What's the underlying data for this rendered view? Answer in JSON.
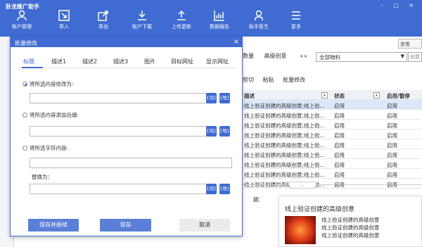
{
  "app": {
    "title": "卧龙推广助手",
    "window_controls": "- □ ×"
  },
  "toolbar": [
    {
      "label": "账户管理",
      "icon": "user-icon"
    },
    {
      "label": "导入",
      "icon": "import-icon"
    },
    {
      "label": "导出",
      "icon": "export-icon"
    },
    {
      "label": "账户下载",
      "icon": "download-icon"
    },
    {
      "label": "上传更新",
      "icon": "upload-icon"
    },
    {
      "label": "数据报告",
      "icon": "chart-icon"
    },
    {
      "label": "助手医生",
      "icon": "doctor-icon"
    },
    {
      "label": "更多",
      "icon": "menu-icon"
    }
  ],
  "background": {
    "tabs": [
      "数量",
      "高级创意"
    ],
    "select_value": "全部物料",
    "creative_hint": "创意",
    "view_button": "查看",
    "toolbar2": [
      "剪切",
      "粘贴",
      "批量修改"
    ],
    "table": {
      "headers": [
        "描述",
        "状态",
        "启用/暂停"
      ],
      "rows": [
        [
          "线上验证创建的高级创意;线上验...",
          "启用",
          "启用"
        ],
        [
          "线上验证创建的高级创意;线上验...",
          "启用",
          "启用"
        ],
        [
          "线上验证创建的高级创意;线上验...",
          "启用",
          "启用"
        ],
        [
          "线上验证创建的高级创意;线上验...",
          "启用",
          "启用"
        ],
        [
          "线上验证创建的高级创意;线上验...",
          "启用",
          "启用"
        ],
        [
          "线上验证创建的高级创意;线上验...",
          "启用",
          "启用"
        ],
        [
          "线上验证创建的高级创意;线上验...",
          "启用",
          "启用"
        ],
        [
          "线上验证创建的高级创意;线上验...",
          "启用",
          "启用"
        ],
        [
          "线上验证创建的高级创意;线上验...",
          "启用",
          "启用"
        ]
      ]
    },
    "side_label": "题:",
    "preview": {
      "title": "线上验证创建的高级创意",
      "lines": [
        "线上验证创建的高级创意",
        "线上验证创建的高级创意",
        "线上验证创建的高级创意"
      ]
    }
  },
  "modal": {
    "title": "批量修改",
    "close": "×",
    "tabs": [
      "标题",
      "描述1",
      "描述2",
      "描述3",
      "图片",
      "目标网址",
      "显示网址"
    ],
    "options": {
      "replace_all": "将所选内容修改为:",
      "append": "将所选内容添加后缀:",
      "replace_chars": "将所选字符内容:",
      "replace_with": "替换为："
    },
    "mini_buttons": {
      "word": "{词}",
      "region": "{地}"
    },
    "buttons": {
      "save_continue": "保存并继续",
      "save": "保存",
      "cancel": "取消"
    }
  },
  "colors": {
    "brand": "#3f6bd2",
    "button_primary": "#5b7fd8"
  }
}
